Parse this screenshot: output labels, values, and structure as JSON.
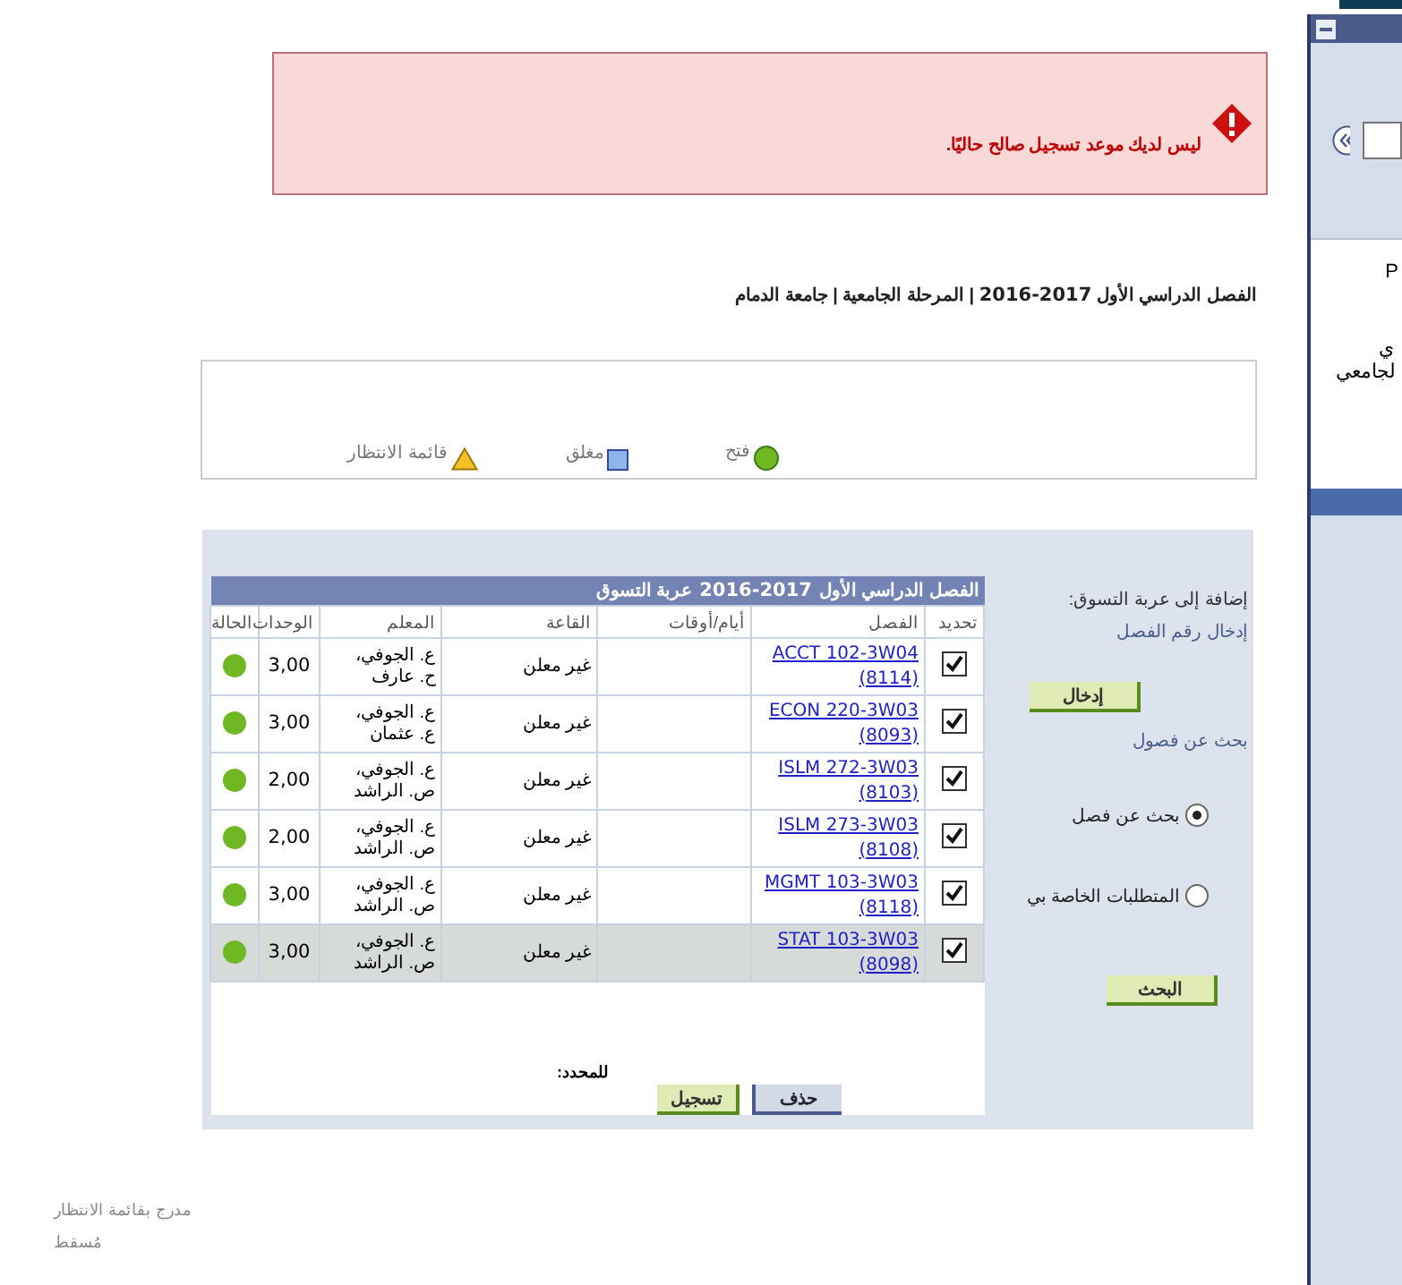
{
  "alert": {
    "kind": "error",
    "message": "ليس لديك موعد تسجيل صالح حاليًا."
  },
  "term_title": {
    "term": "الفصل الدراسي الأول",
    "years": "2016-2017",
    "separators": [
      "|",
      "|"
    ],
    "level": "المرحلة الجامعية",
    "university": "جامعة الدمام"
  },
  "legend": [
    {
      "kind": "open",
      "label": "فتح"
    },
    {
      "kind": "closed",
      "label": "مغلق"
    },
    {
      "kind": "waitlist",
      "label": "قائمة الانتظار"
    }
  ],
  "cart": {
    "caption_prefix": "الفصل الدراسي الأول",
    "caption_years": "2016-2017",
    "caption_suffix": "عربة التسوق",
    "columns": [
      "تحديد",
      "الفصل",
      "أيام/أوقات",
      "القاعة",
      "المعلم",
      "الوحدات",
      "الحالة"
    ],
    "rows": [
      {
        "checked": true,
        "selected": false,
        "course": "ACCT 102-3W04",
        "class_no": "(8114)",
        "days_times": "",
        "room": "غير معلن",
        "instructor": [
          "ع. الجوفي،",
          "ح. عارف"
        ],
        "units": "3,00",
        "color": "#70b823"
      },
      {
        "checked": true,
        "selected": false,
        "course": "ECON 220-3W03",
        "class_no": "(8093)",
        "days_times": "",
        "room": "غير معلن",
        "instructor": [
          "ع. الجوفي،",
          "ع. عثمان"
        ],
        "units": "3,00",
        "color": "#70b823"
      },
      {
        "checked": true,
        "selected": false,
        "course": "ISLM 272-3W03",
        "class_no": "(8103)",
        "days_times": "",
        "room": "غير معلن",
        "instructor": [
          "ع. الجوفي،",
          "ص. الراشد"
        ],
        "units": "2,00",
        "color": "#70b823"
      },
      {
        "checked": true,
        "selected": false,
        "course": "ISLM 273-3W03",
        "class_no": "(8108)",
        "days_times": "",
        "room": "غير معلن",
        "instructor": [
          "ع. الجوفي،",
          "ص. الراشد"
        ],
        "units": "2,00",
        "color": "#70b823"
      },
      {
        "checked": true,
        "selected": false,
        "course": "MGMT 103-3W03",
        "class_no": "(8118)",
        "days_times": "",
        "room": "غير معلن",
        "instructor": [
          "ع. الجوفي،",
          "ص. الراشد"
        ],
        "units": "3,00",
        "color": "#70b823"
      },
      {
        "checked": true,
        "selected": true,
        "course": "STAT 103-3W03",
        "class_no": "(8098)",
        "days_times": "",
        "room": "غير معلن",
        "instructor": [
          "ع. الجوفي،",
          "ص. الراشد"
        ],
        "units": "3,00",
        "color": "#70b823"
      }
    ],
    "selected_label": "للمحدد:",
    "buttons": [
      "حذف",
      "تسجيل"
    ]
  },
  "add_panel": {
    "title": "إضافة إلى عربة التسوق:",
    "enter_label": "إدخال رقم الفصل",
    "enter_button": "إدخال",
    "search_title": "بحث عن فصول",
    "options": [
      {
        "label": "بحث عن فصل",
        "selected": true
      },
      {
        "label": "المتطلبات الخاصة بي",
        "selected": false
      }
    ],
    "search_button": "البحث"
  },
  "footer_legend": [
    "مدرج بقائمة الانتظار",
    "مُسقط"
  ],
  "side_panel": {
    "texts": [
      "P",
      "ي",
      "لجامعي"
    ]
  }
}
